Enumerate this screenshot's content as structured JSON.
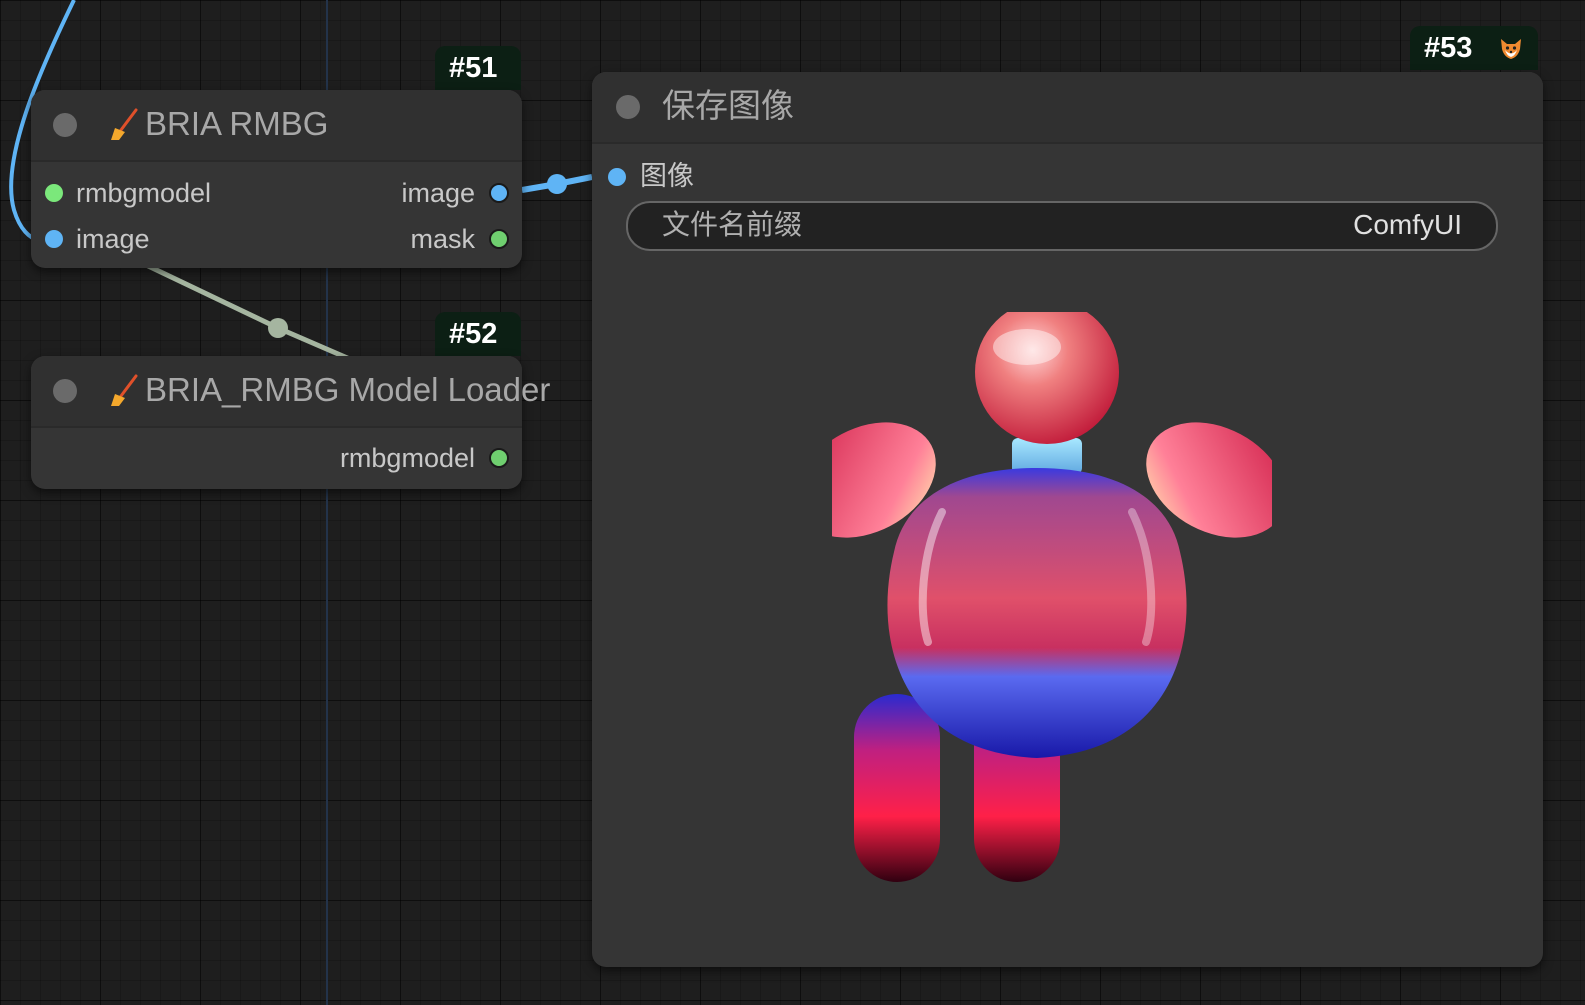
{
  "nodes": {
    "bria_rmbg": {
      "badge": "#51",
      "title": "BRIA RMBG",
      "icon": "broom-icon",
      "inputs": [
        "rmbgmodel",
        "image"
      ],
      "outputs": [
        "image",
        "mask"
      ]
    },
    "model_loader": {
      "badge": "#52",
      "title": "BRIA_RMBG Model Loader",
      "icon": "broom-icon",
      "outputs": [
        "rmbgmodel"
      ]
    },
    "save_image": {
      "badge": "#53",
      "badge_icon": "fox-icon",
      "title": "保存图像",
      "input": "图像",
      "widget": {
        "name": "文件名前缀",
        "value": "ComfyUI"
      },
      "preview": "image-preview"
    }
  },
  "colors": {
    "canvas": "#1e1e1e",
    "node_body": "#353535",
    "node_header": "#303030",
    "badge": "#0c1f14",
    "image_slot": "#5fb4f5",
    "model_slot": "#7be87b",
    "mask_slot": "#6fcf6f",
    "link_image": "#5fb4f5",
    "link_model": "#a5b5a0"
  }
}
